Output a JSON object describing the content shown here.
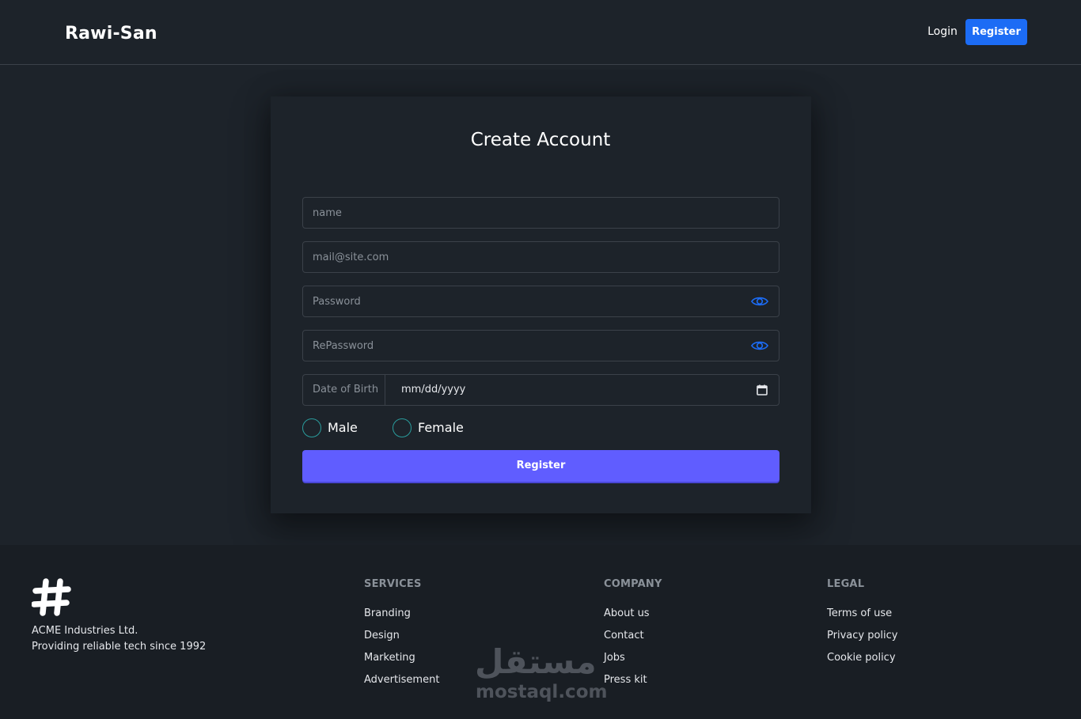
{
  "navbar": {
    "brand": "Rawi-San",
    "login_label": "Login",
    "register_label": "Register"
  },
  "form": {
    "title": "Create Account",
    "name_placeholder": "name",
    "email_placeholder": "mail@site.com",
    "password_placeholder": "Password",
    "repassword_placeholder": "RePassword",
    "dob_label": "Date of Birth",
    "dob_value": "mm/dd/yyyy",
    "gender_options": [
      "Male",
      "Female"
    ],
    "submit_label": "Register"
  },
  "footer": {
    "company_name": "ACME Industries Ltd.",
    "tagline": "Providing reliable tech since 1992",
    "columns": [
      {
        "title": "SERVICES",
        "links": [
          "Branding",
          "Design",
          "Marketing",
          "Advertisement"
        ]
      },
      {
        "title": "COMPANY",
        "links": [
          "About us",
          "Contact",
          "Jobs",
          "Press kit"
        ]
      },
      {
        "title": "LEGAL",
        "links": [
          "Terms of use",
          "Privacy policy",
          "Cookie policy"
        ]
      }
    ]
  },
  "watermark": {
    "arabic": "مستقل",
    "latin": "mostaql.com"
  },
  "colors": {
    "background": "#1d232a",
    "footer_bg": "#191e24",
    "primary_blue": "#1c6cf5",
    "submit_purple": "#605dff",
    "radio_teal": "#2a9d9d"
  },
  "icons": [
    "eye-icon",
    "calendar-icon",
    "hash-logo-icon"
  ]
}
